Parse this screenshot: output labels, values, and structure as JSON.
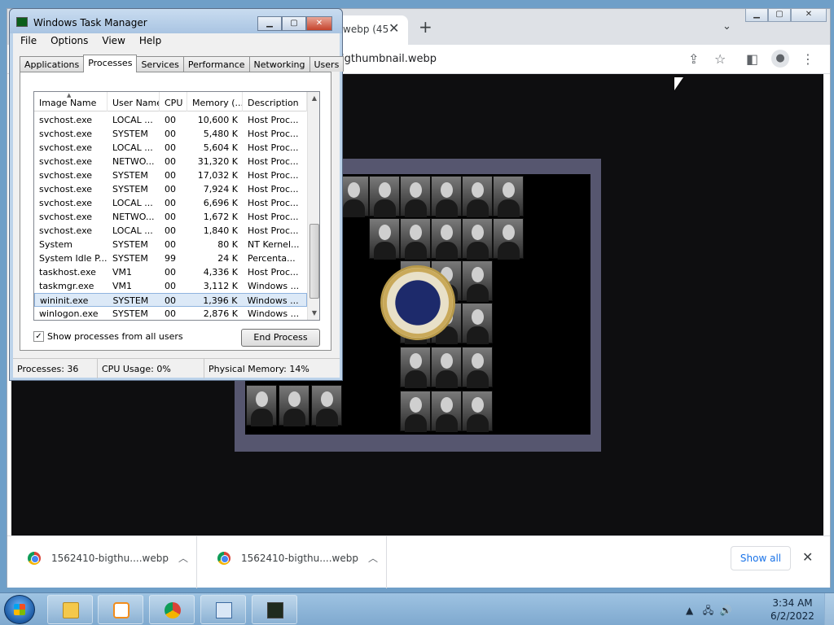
{
  "browser": {
    "tab_title": "webp (45",
    "url": "igthumbnail.webp",
    "downloads": [
      {
        "name": "1562410-bigthu....webp"
      },
      {
        "name": "1562410-bigthu....webp"
      }
    ],
    "show_all_label": "Show all"
  },
  "task_manager": {
    "title": "Windows Task Manager",
    "menu": [
      "File",
      "Options",
      "View",
      "Help"
    ],
    "tabs": [
      "Applications",
      "Processes",
      "Services",
      "Performance",
      "Networking",
      "Users"
    ],
    "active_tab": "Processes",
    "columns": [
      "Image Name",
      "User Name",
      "CPU",
      "Memory (...",
      "Description"
    ],
    "rows": [
      {
        "image": "svchost.exe",
        "user": "LOCAL ...",
        "cpu": "00",
        "memory": "10,600 K",
        "desc": "Host Proc..."
      },
      {
        "image": "svchost.exe",
        "user": "SYSTEM",
        "cpu": "00",
        "memory": "5,480 K",
        "desc": "Host Proc..."
      },
      {
        "image": "svchost.exe",
        "user": "LOCAL ...",
        "cpu": "00",
        "memory": "5,604 K",
        "desc": "Host Proc..."
      },
      {
        "image": "svchost.exe",
        "user": "NETWO...",
        "cpu": "00",
        "memory": "31,320 K",
        "desc": "Host Proc..."
      },
      {
        "image": "svchost.exe",
        "user": "SYSTEM",
        "cpu": "00",
        "memory": "17,032 K",
        "desc": "Host Proc..."
      },
      {
        "image": "svchost.exe",
        "user": "SYSTEM",
        "cpu": "00",
        "memory": "7,924 K",
        "desc": "Host Proc..."
      },
      {
        "image": "svchost.exe",
        "user": "LOCAL ...",
        "cpu": "00",
        "memory": "6,696 K",
        "desc": "Host Proc..."
      },
      {
        "image": "svchost.exe",
        "user": "NETWO...",
        "cpu": "00",
        "memory": "1,672 K",
        "desc": "Host Proc..."
      },
      {
        "image": "svchost.exe",
        "user": "LOCAL ...",
        "cpu": "00",
        "memory": "1,840 K",
        "desc": "Host Proc..."
      },
      {
        "image": "System",
        "user": "SYSTEM",
        "cpu": "00",
        "memory": "80 K",
        "desc": "NT Kernel..."
      },
      {
        "image": "System Idle P...",
        "user": "SYSTEM",
        "cpu": "99",
        "memory": "24 K",
        "desc": "Percenta..."
      },
      {
        "image": "taskhost.exe",
        "user": "VM1",
        "cpu": "00",
        "memory": "4,336 K",
        "desc": "Host Proc..."
      },
      {
        "image": "taskmgr.exe",
        "user": "VM1",
        "cpu": "00",
        "memory": "3,112 K",
        "desc": "Windows ..."
      },
      {
        "image": "wininit.exe",
        "user": "SYSTEM",
        "cpu": "00",
        "memory": "1,396 K",
        "desc": "Windows ..."
      },
      {
        "image": "winlogon.exe",
        "user": "SYSTEM",
        "cpu": "00",
        "memory": "2,876 K",
        "desc": "Windows ..."
      }
    ],
    "selected_row_index": 13,
    "show_all_users_label": "Show processes from all users",
    "show_all_users_checked": true,
    "end_process_label": "End Process",
    "status": {
      "processes": "Processes: 36",
      "cpu_usage": "CPU Usage: 0%",
      "physical_memory": "Physical Memory: 14%"
    }
  },
  "taskbar": {
    "apps": [
      "windows-explorer",
      "media-player",
      "google-chrome",
      "control-panel",
      "task-manager"
    ],
    "time": "3:34 AM",
    "date": "6/2/2022"
  }
}
